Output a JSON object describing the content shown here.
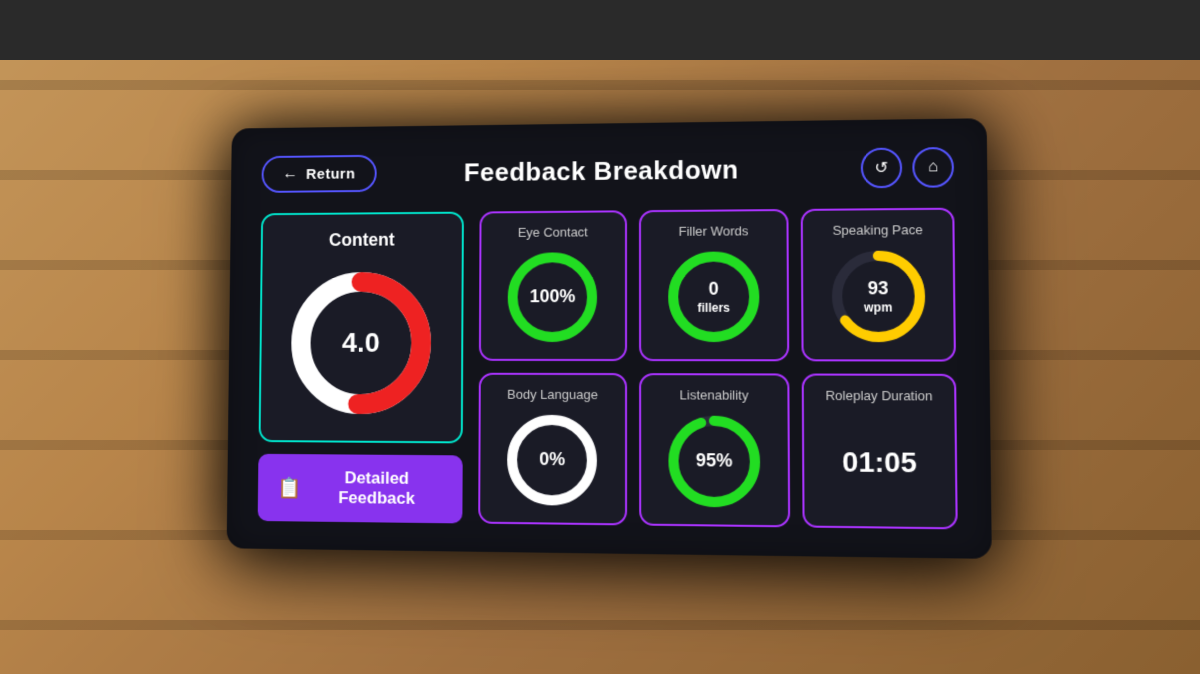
{
  "header": {
    "return_label": "Return",
    "title": "Feedback Breakdown",
    "icon_refresh": "↺",
    "icon_home": "⌂"
  },
  "content_card": {
    "label": "Content",
    "score": "4.0",
    "donut": {
      "total": 5,
      "value": 4,
      "bg_color": "#ffffff",
      "fill_color": "#ee2222",
      "track_color": "#333344",
      "radius": 70,
      "stroke_width": 18
    }
  },
  "detailed_feedback_btn": {
    "label": "Detailed Feedback",
    "icon": "📋"
  },
  "metrics": [
    {
      "id": "eye-contact",
      "label": "Eye Contact",
      "display": "100%",
      "unit": "",
      "type": "donut",
      "value": 100,
      "max": 100,
      "color": "#22dd22",
      "track_color": "#333344",
      "bg_color": "#333344"
    },
    {
      "id": "filler-words",
      "label": "Filler Words",
      "display": "0",
      "unit": "fillers",
      "type": "donut",
      "value": 0,
      "max": 100,
      "color": "#22dd22",
      "track_color": "#333344",
      "bg_color": "#1a1b26"
    },
    {
      "id": "speaking-pace",
      "label": "Speaking Pace",
      "display": "93",
      "unit": "wpm",
      "type": "donut",
      "value": 65,
      "max": 100,
      "color": "#ffcc00",
      "track_color": "#333344",
      "bg_color": "#1a1b26"
    },
    {
      "id": "body-language",
      "label": "Body Language",
      "display": "0%",
      "unit": "",
      "type": "donut",
      "value": 0,
      "max": 100,
      "color": "#ffffff",
      "track_color": "#333344",
      "bg_color": "#1a1b26"
    },
    {
      "id": "listenability",
      "label": "Listenability",
      "display": "95%",
      "unit": "",
      "type": "donut",
      "value": 95,
      "max": 100,
      "color": "#22dd22",
      "track_color": "#333344",
      "bg_color": "#1a1b26"
    },
    {
      "id": "roleplay-duration",
      "label": "Roleplay Duration",
      "display": "01:05",
      "unit": "",
      "type": "text"
    }
  ]
}
